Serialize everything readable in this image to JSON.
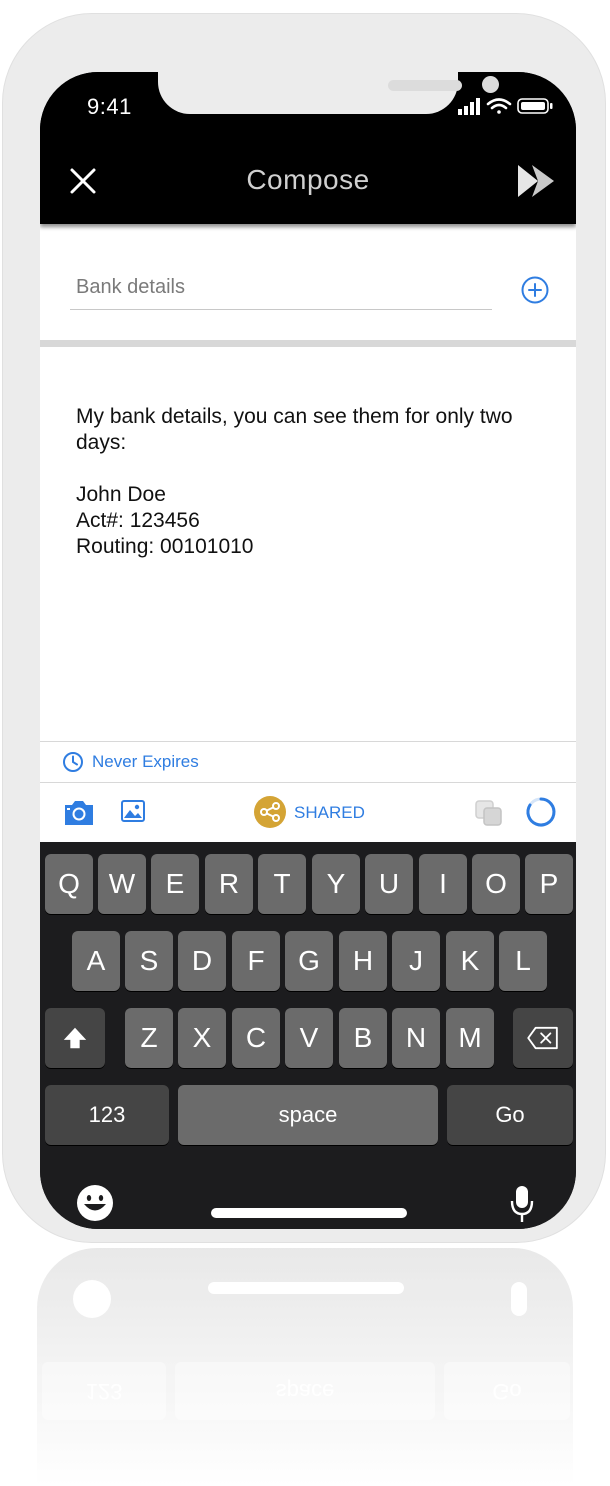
{
  "status_bar": {
    "time": "9:41"
  },
  "app_bar": {
    "title": "Compose",
    "close_icon": "close-icon",
    "send_icon": "send-icon"
  },
  "subject": {
    "value": "Bank details"
  },
  "message": {
    "lines": [
      "My bank details, you can see them for only two days:",
      "John Doe",
      "Act#: 123456",
      "Routing: 00101010"
    ]
  },
  "expiry": {
    "label": "Never Expires"
  },
  "toolbar": {
    "shared_label": "SHARED"
  },
  "keyboard": {
    "row1": [
      "Q",
      "W",
      "E",
      "R",
      "T",
      "Y",
      "U",
      "I",
      "O",
      "P"
    ],
    "row2": [
      "A",
      "S",
      "D",
      "F",
      "G",
      "H",
      "J",
      "K",
      "L"
    ],
    "row3": [
      "Z",
      "X",
      "C",
      "V",
      "B",
      "N",
      "M"
    ],
    "numbers_key": "123",
    "space_key": "space",
    "go_key": "Go"
  },
  "colors": {
    "accent": "#2f7de1",
    "shared_badge": "#d4a435",
    "app_bar": "#000000"
  }
}
